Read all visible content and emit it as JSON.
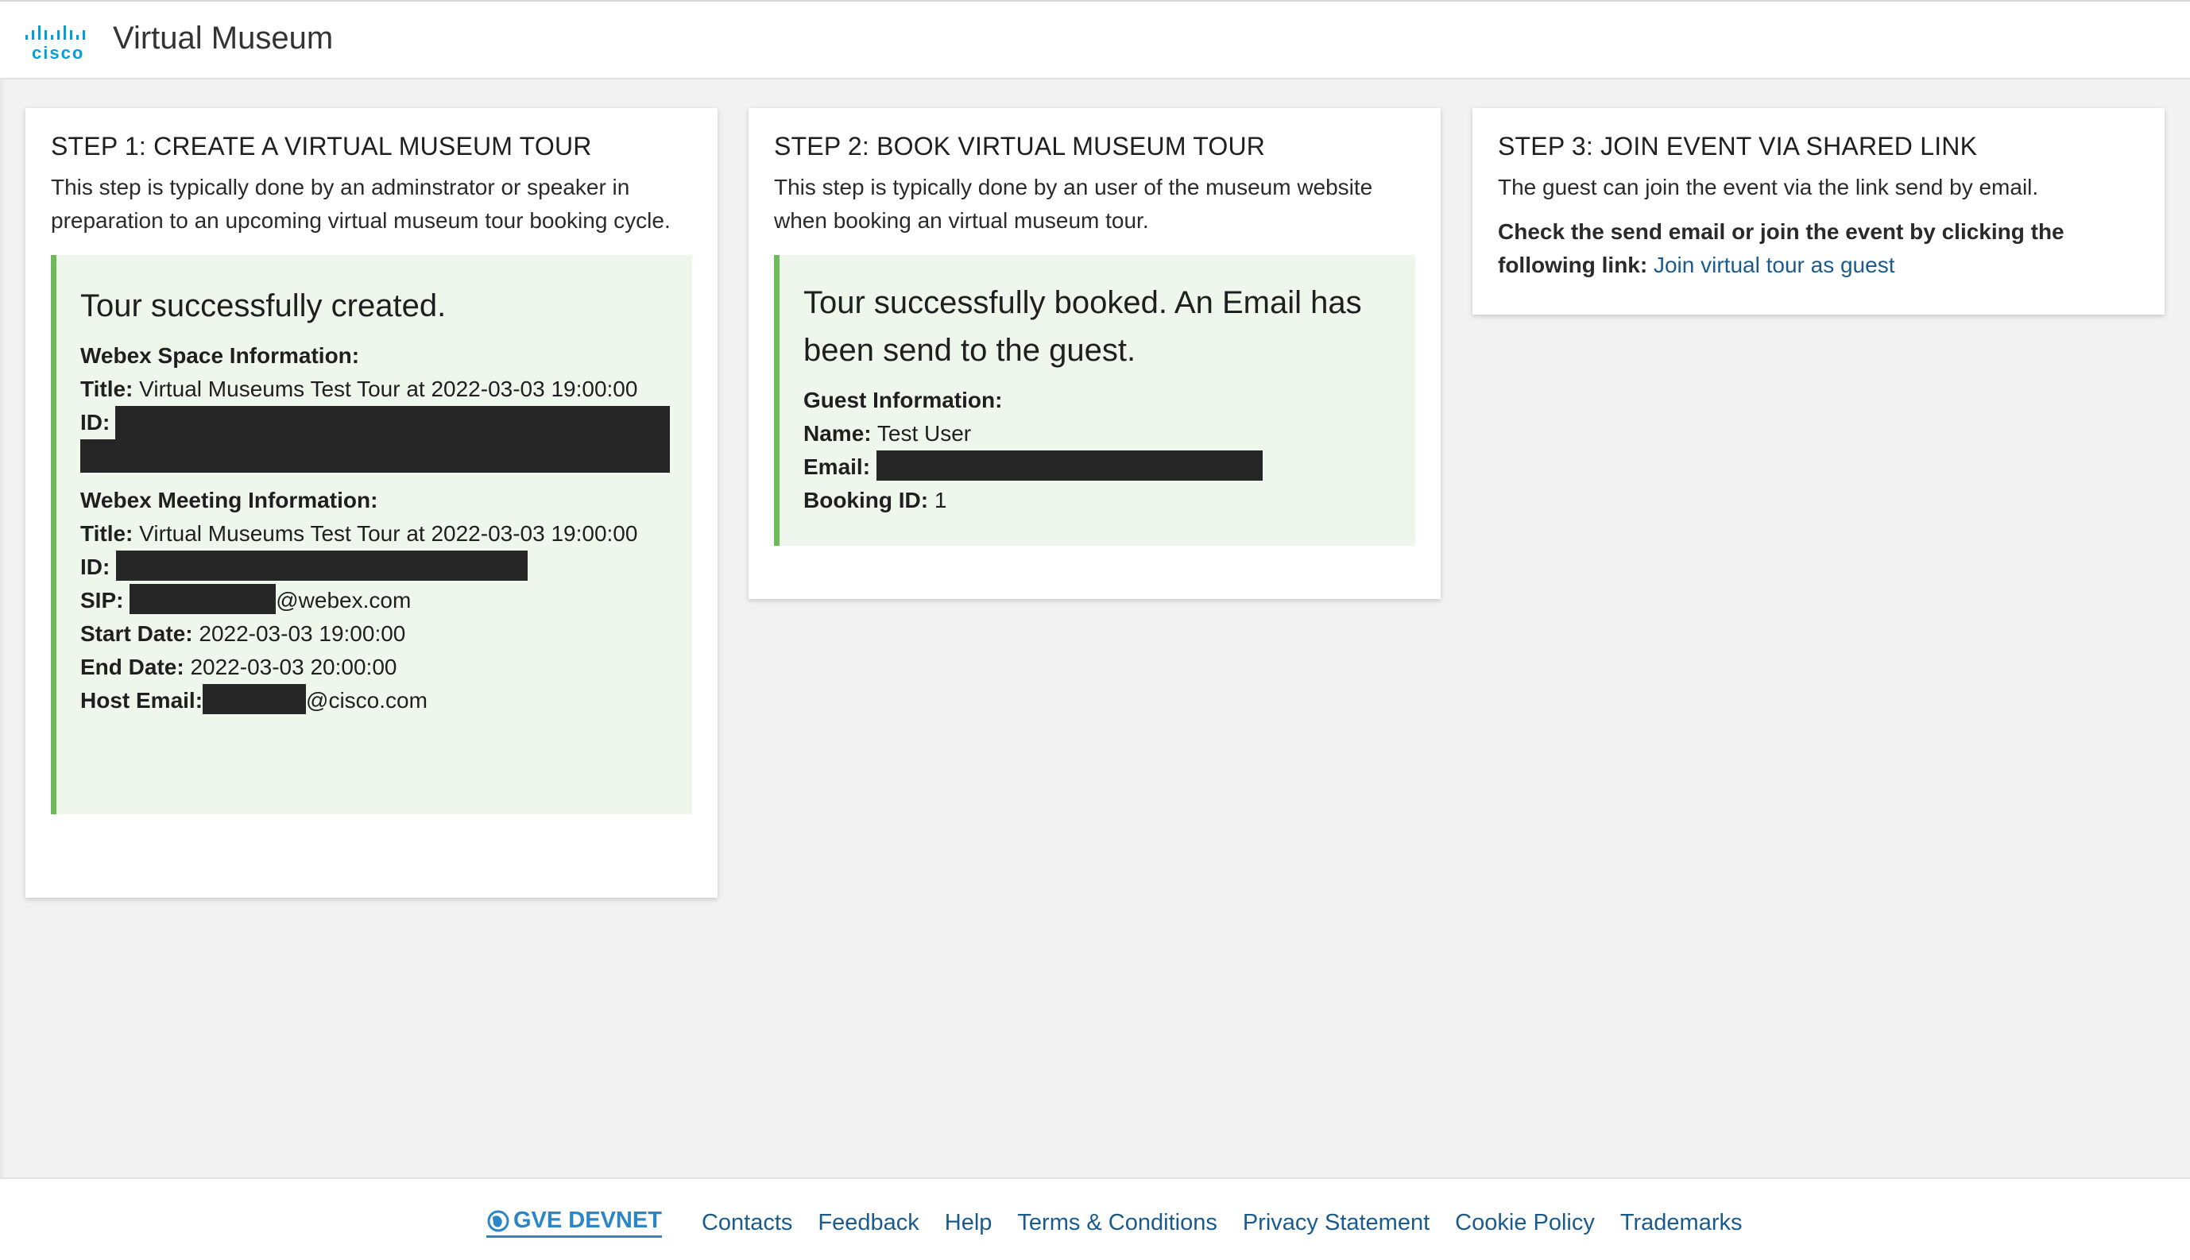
{
  "header": {
    "brand": "cisco",
    "title": "Virtual Museum"
  },
  "step1": {
    "heading": "STEP 1: CREATE A VIRTUAL MUSEUM TOUR",
    "description": "This step is typically done by an adminstrator or speaker in preparation to an upcoming virtual museum tour booking cycle.",
    "success_title": "Tour successfully created.",
    "space_heading": "Webex Space Information:",
    "space_title_label": "Title:",
    "space_title_value": "Virtual Museums Test Tour at 2022-03-03 19:00:00",
    "space_id_label": "ID:",
    "meeting_heading": "Webex Meeting Information:",
    "meeting_title_label": "Title:",
    "meeting_title_value": "Virtual Museums Test Tour at 2022-03-03 19:00:00",
    "meeting_id_label": "ID:",
    "sip_label": "SIP:",
    "sip_suffix": "@webex.com",
    "start_label": "Start Date:",
    "start_value": "2022-03-03 19:00:00",
    "end_label": "End Date:",
    "end_value": "2022-03-03 20:00:00",
    "host_label": "Host Email:",
    "host_suffix": "@cisco.com"
  },
  "step2": {
    "heading": "STEP 2: BOOK VIRTUAL MUSEUM TOUR",
    "description": "This step is typically done by an user of the museum website when booking an virtual museum tour.",
    "success_title": "Tour successfully booked. An Email has been send to the guest.",
    "guest_heading": "Guest Information:",
    "name_label": "Name:",
    "name_value": "Test User",
    "email_label": "Email:",
    "booking_label": "Booking ID:",
    "booking_value": "1"
  },
  "step3": {
    "heading": "STEP 3: JOIN EVENT VIA SHARED LINK",
    "description": "The guest can join the event via the link send by email.",
    "instruction": "Check the send email or join the event by clicking the following link:",
    "link_text": "Join virtual tour as guest"
  },
  "footer": {
    "logo_text": "GVE DEVNET",
    "links": [
      "Contacts",
      "Feedback",
      "Help",
      "Terms & Conditions",
      "Privacy Statement",
      "Cookie Policy",
      "Trademarks"
    ]
  },
  "colors": {
    "accent_link": "#1a5b8f",
    "success_border": "#6cba58",
    "success_bg": "#eff6ec",
    "cisco_blue": "#049fd9"
  }
}
